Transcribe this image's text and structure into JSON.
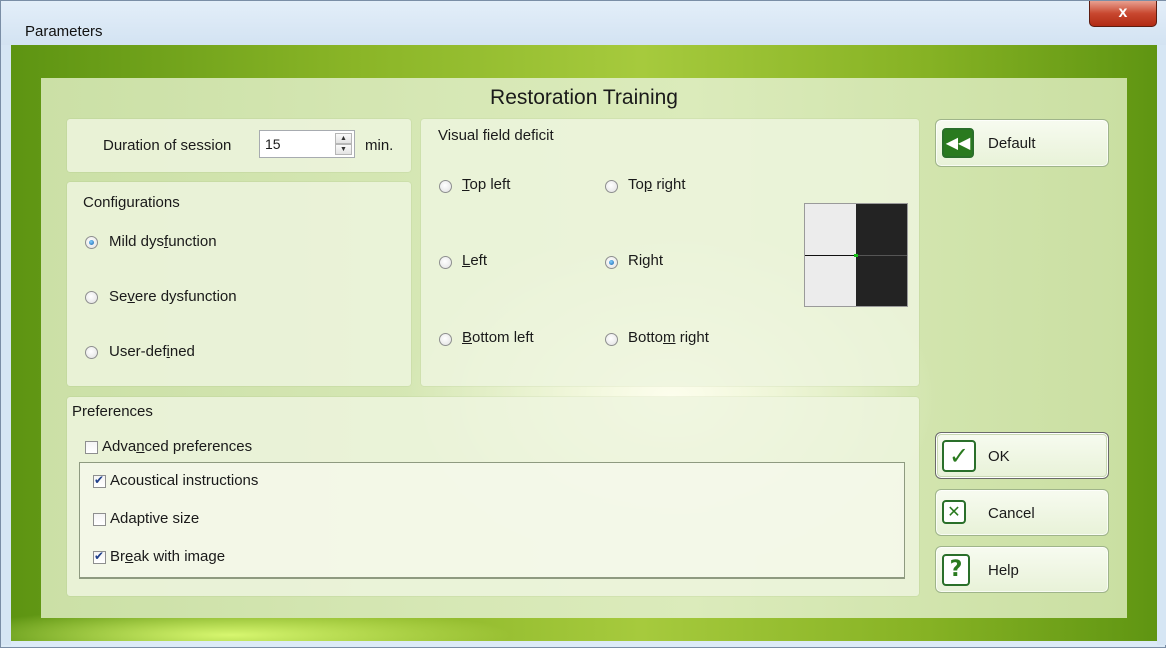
{
  "window": {
    "title": "Parameters",
    "close_glyph": "x"
  },
  "heading": "Restoration Training",
  "duration": {
    "label": "Duration of session",
    "value": "15",
    "unit": "min."
  },
  "configurations": {
    "title": "Configurations",
    "options": [
      {
        "pre": "Mild dys",
        "u": "f",
        "post": "unction",
        "selected": true
      },
      {
        "pre": "Se",
        "u": "v",
        "post": "ere dysfunction",
        "selected": false
      },
      {
        "pre": "User-def",
        "u": "i",
        "post": "ned",
        "selected": false
      }
    ]
  },
  "visual_field": {
    "title": "Visual field deficit",
    "options": [
      {
        "pre": "",
        "u": "T",
        "post": "op left",
        "selected": false
      },
      {
        "pre": "To",
        "u": "p",
        "post": " right",
        "selected": false
      },
      {
        "pre": "",
        "u": "L",
        "post": "eft",
        "selected": false
      },
      {
        "pre": "Ri",
        "u": "g",
        "post": "ht",
        "selected": true
      },
      {
        "pre": "",
        "u": "B",
        "post": "ottom left",
        "selected": false
      },
      {
        "pre": "Botto",
        "u": "m",
        "post": " right",
        "selected": false
      }
    ],
    "preview_colors": {
      "intact": "#ececec",
      "deficit": "#232323",
      "fixation": "#19c019"
    }
  },
  "preferences": {
    "title": "Preferences",
    "advanced": {
      "pre": "Adva",
      "u": "n",
      "post": "ced preferences",
      "checked": false
    },
    "items": [
      {
        "pre": "",
        "u": "",
        "post": "Acoustical instructions",
        "checked": true
      },
      {
        "pre": "",
        "u": "",
        "post": "Adaptive size",
        "checked": false
      },
      {
        "pre": "Br",
        "u": "e",
        "post": "ak with image",
        "checked": true
      }
    ]
  },
  "buttons": {
    "default": {
      "label": "Default",
      "icon": "rewind-icon"
    },
    "ok": {
      "label": "OK",
      "icon": "checkmark-icon"
    },
    "cancel": {
      "label": "Cancel",
      "icon": "x-icon"
    },
    "help": {
      "label": "Help",
      "icon": "question-icon"
    }
  },
  "colors": {
    "frame_green": "#8ab527",
    "panel_bg": "#edf5de",
    "accent_blue": "#1a5fa8"
  }
}
